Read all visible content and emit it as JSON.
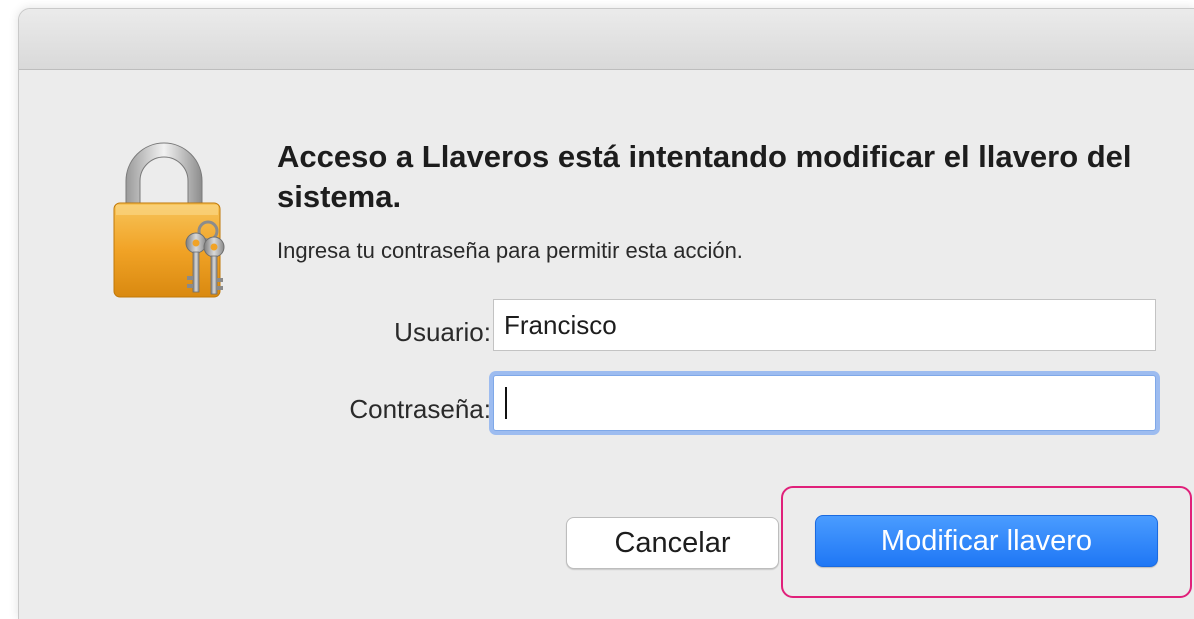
{
  "dialog": {
    "heading": "Acceso a Llaveros está intentando modificar el llavero del sistema.",
    "subtitle": "Ingresa tu contraseña para permitir esta acción.",
    "icon": "padlock-with-keys-icon"
  },
  "form": {
    "username_label": "Usuario:",
    "username_value": "Francisco",
    "password_label": "Contraseña:",
    "password_value": ""
  },
  "buttons": {
    "cancel_label": "Cancelar",
    "primary_label": "Modificar llavero"
  },
  "colors": {
    "primary_button": "#1f77f5",
    "focus_ring": "#9dbcf0",
    "highlight_outline": "#e0207a",
    "lock_body": "#f0a020"
  }
}
